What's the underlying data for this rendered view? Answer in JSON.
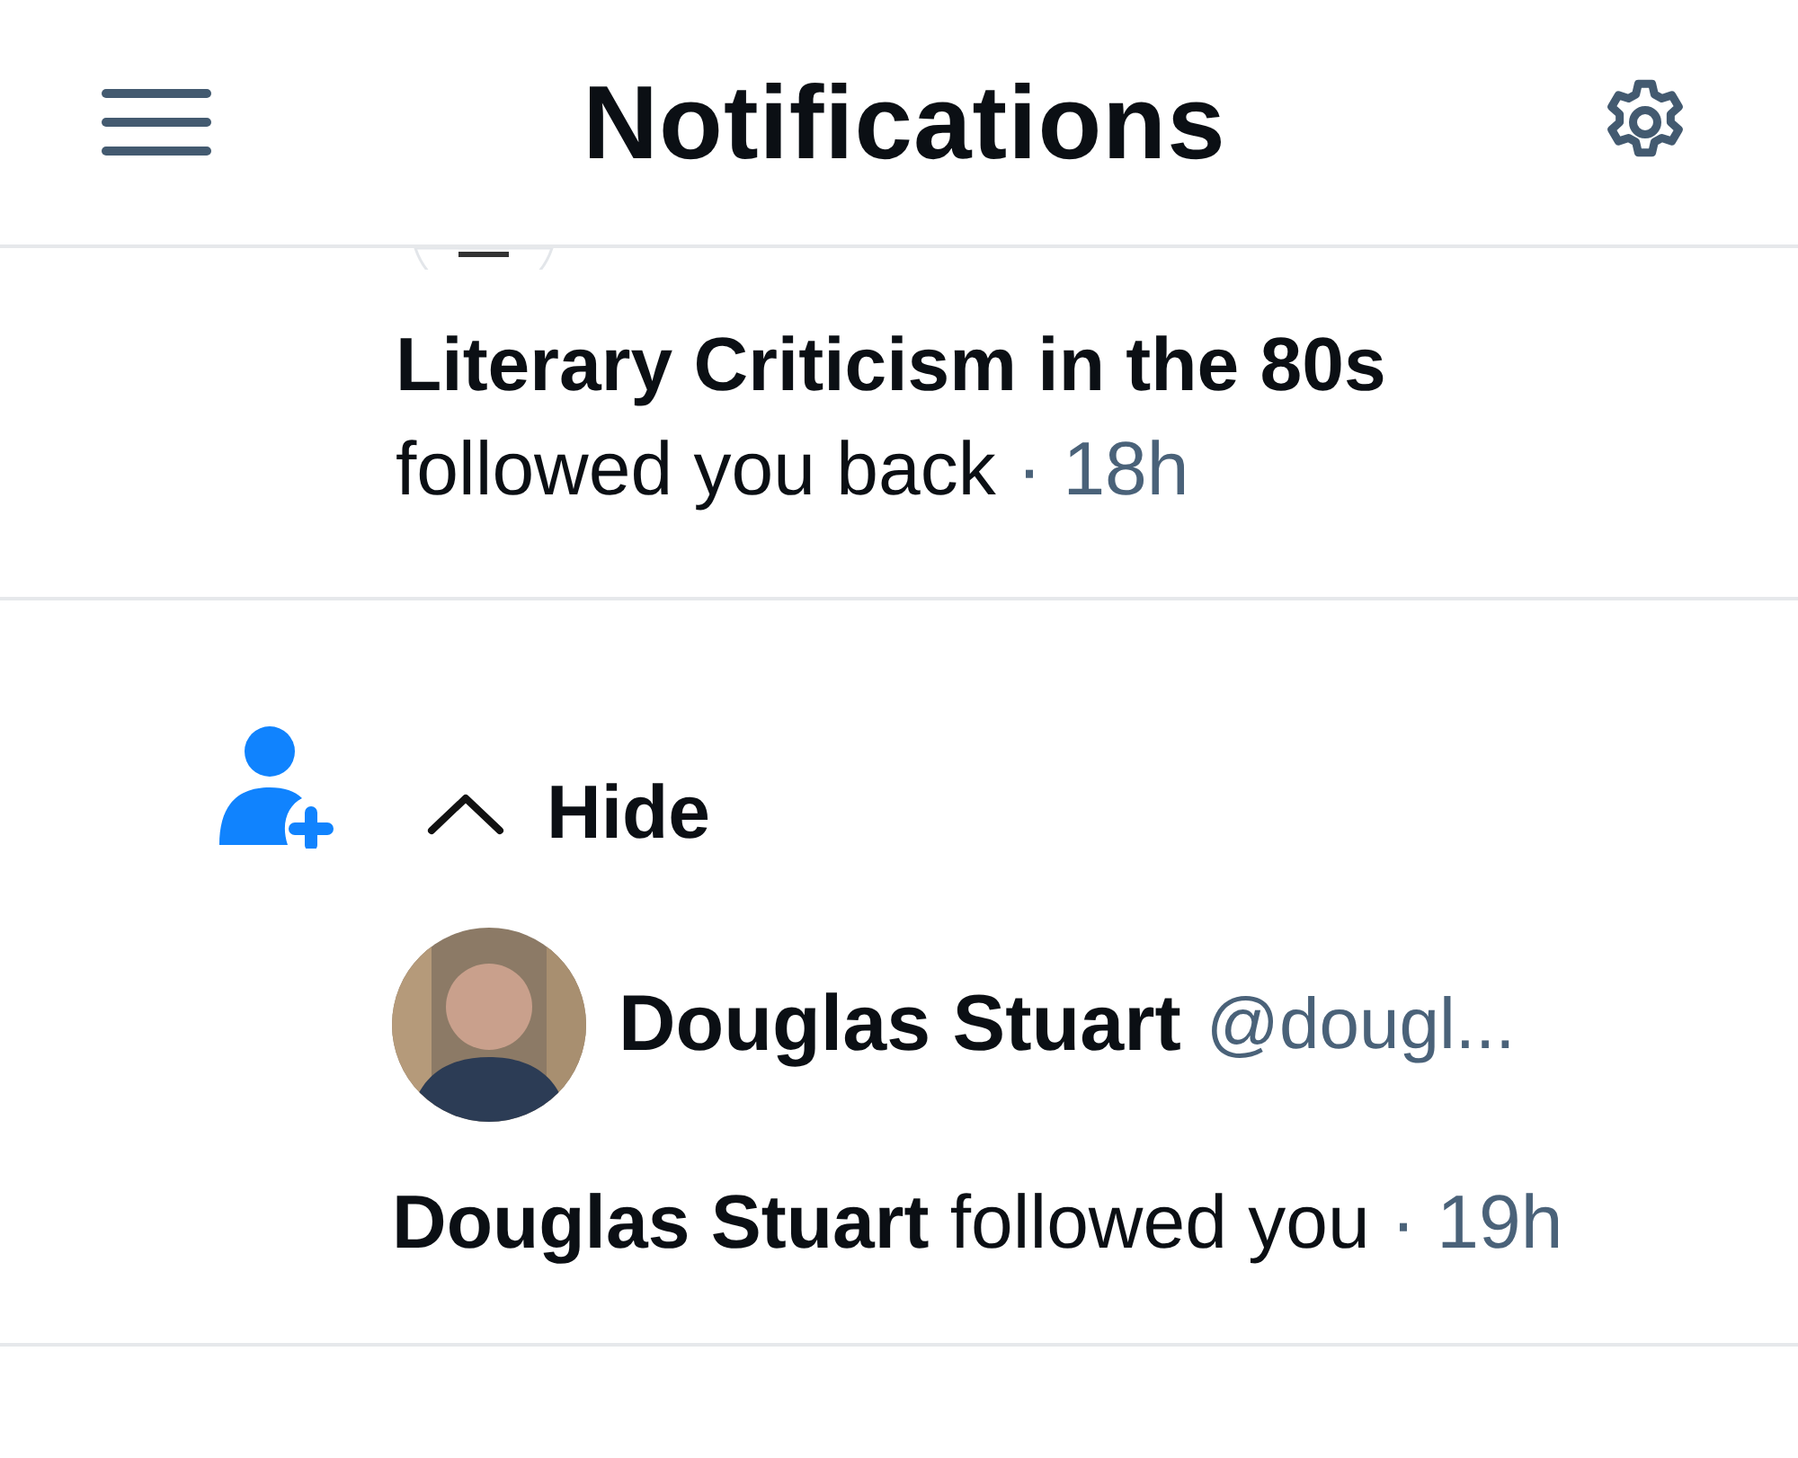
{
  "header": {
    "title": "Notifications"
  },
  "notifications": [
    {
      "kind": "followback",
      "account": "Literary Criticism in the 80s",
      "action": "followed you back",
      "time": "· 18h"
    },
    {
      "kind": "follow",
      "toggle": "Hide",
      "expanded": true,
      "user": {
        "name": "Douglas Stuart",
        "handle": "@dougl..."
      },
      "actor": "Douglas Stuart",
      "action": "followed you",
      "time": "· 19h"
    }
  ]
}
